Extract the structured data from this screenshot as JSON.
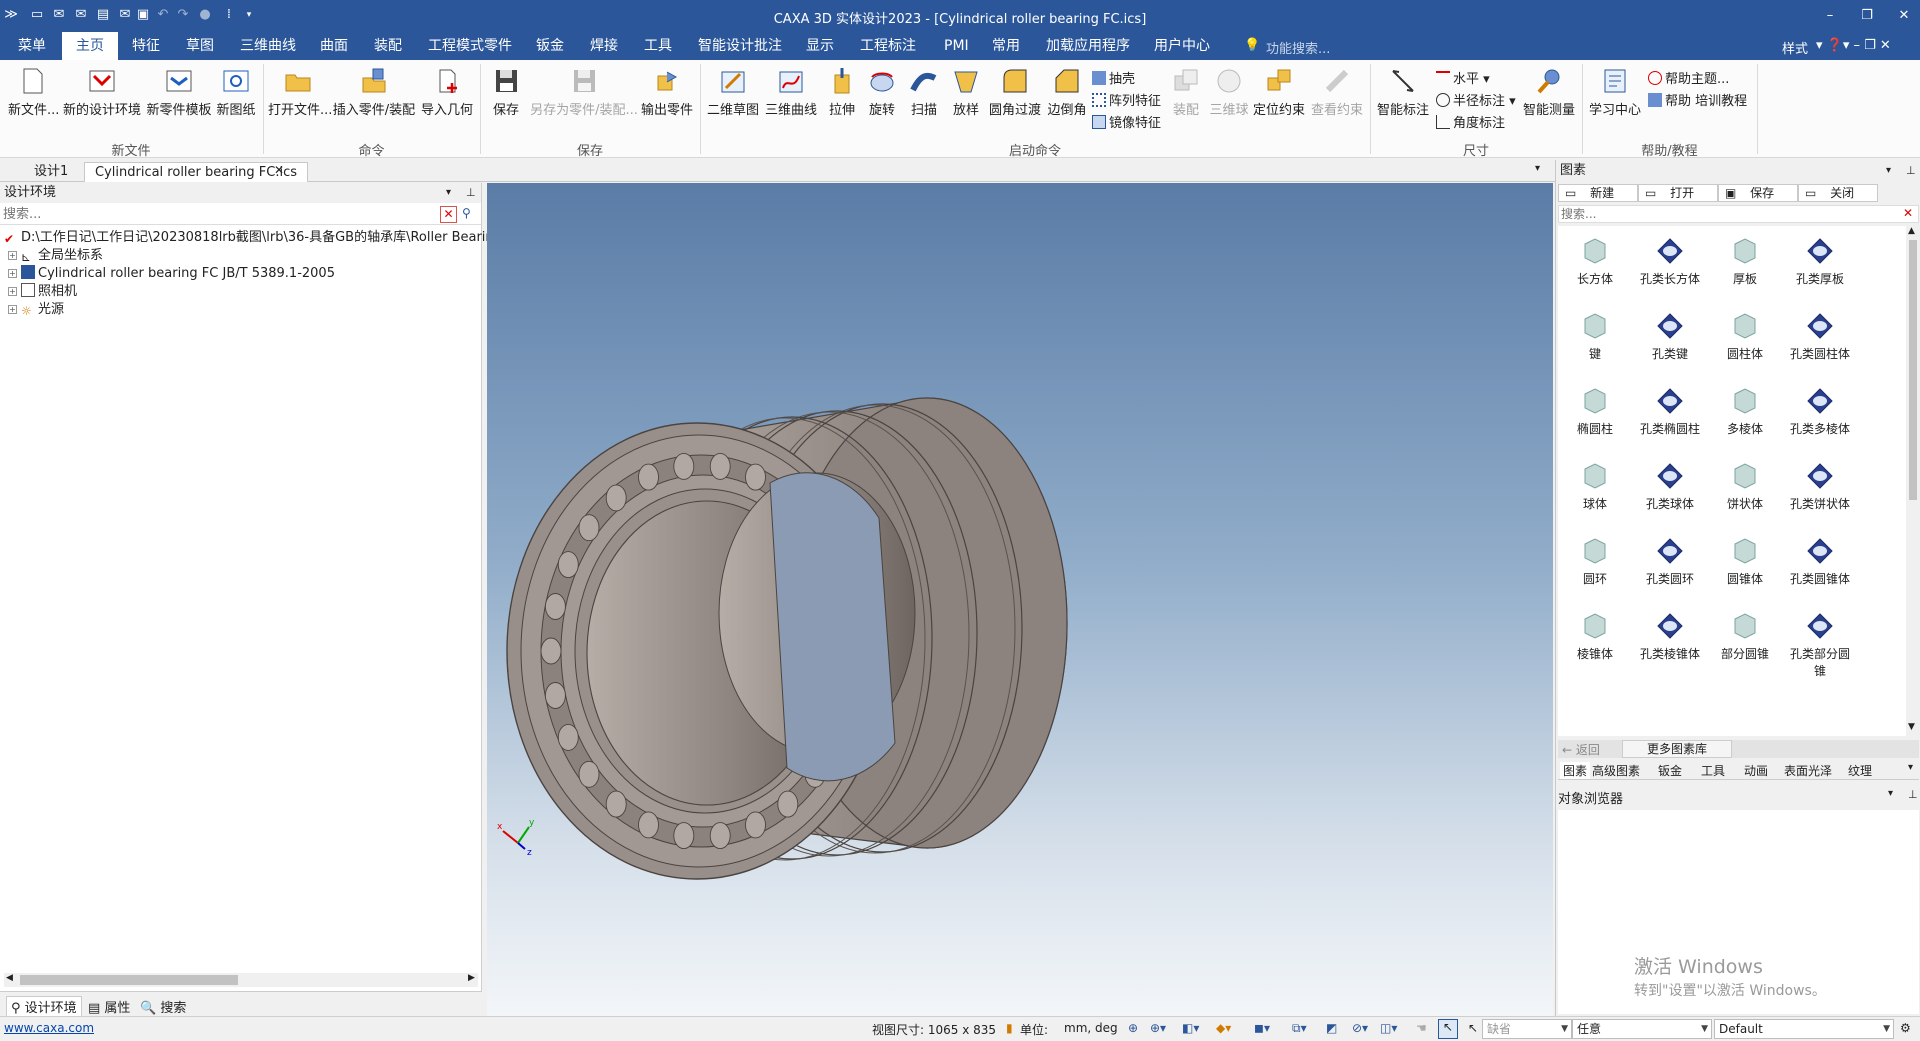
{
  "window": {
    "title": "CAXA 3D 实体设计2023 - [Cylindrical roller bearing FC.ics]"
  },
  "menu_tabs": [
    "菜单",
    "主页",
    "特征",
    "草图",
    "三维曲线",
    "曲面",
    "装配",
    "工程模式零件",
    "钣金",
    "焊接",
    "工具",
    "智能设计批注",
    "显示",
    "工程标注",
    "PMI",
    "常用",
    "加载应用程序",
    "用户中心"
  ],
  "menu_active": "主页",
  "function_search": "功能搜索...",
  "style_label": "样式",
  "ribbon": {
    "new_file": {
      "btn1": "新文件...",
      "btn2": "新的设计环境",
      "btn3": "新零件模板",
      "btn4": "新图纸",
      "group": "新文件"
    },
    "command": {
      "btn1": "打开文件...",
      "btn2": "插入零件/装配",
      "btn3": "导入几何",
      "group": "命令"
    },
    "save": {
      "btn1": "保存",
      "btn2": "另存为零件/装配...",
      "btn3": "输出零件",
      "group": "保存"
    },
    "launch": {
      "btn1": "二维草图",
      "btn2": "三维曲线",
      "btn3": "拉伸",
      "btn4": "旋转",
      "btn5": "扫描",
      "btn6": "放样",
      "btn7": "圆角过渡",
      "btn8": "边倒角",
      "s1": "抽壳",
      "s2": "阵列特征",
      "s3": "镜像特征",
      "btn9": "装配",
      "btn10": "三维球",
      "btn11": "定位约束",
      "btn12": "查看约束",
      "group": "启动命令"
    },
    "dimension": {
      "btn1": "智能标注",
      "s1": "水平",
      "s2": "半径标注",
      "s3": "角度标注",
      "btn2": "智能测量",
      "group": "尺寸"
    },
    "help": {
      "btn1": "学习中心",
      "s1": "帮助主题...",
      "s2": "帮助 培训教程",
      "group": "帮助/教程"
    }
  },
  "doc_tabs": [
    "设计1",
    "Cylindrical roller bearing FC.ics"
  ],
  "left_panel": {
    "title": "设计环境",
    "search_placeholder": "搜索...",
    "tree": {
      "root": "D:\\工作日记\\工作日记\\20230818lrb截图\\lrb\\36-具备GB的轴承库\\Roller Bearings\\",
      "item1": "全局坐标系",
      "item2": "Cylindrical roller bearing FC JB/T 5389.1-2005",
      "item3": "照相机",
      "item4": "光源"
    },
    "bottom_tabs": [
      "设计环境",
      "属性",
      "搜索"
    ]
  },
  "right_panel": {
    "title": "图素",
    "buttons": [
      "新建",
      "打开",
      "保存",
      "关闭"
    ],
    "search_placeholder": "搜索...",
    "items": [
      "长方体",
      "孔类长方体",
      "厚板",
      "孔类厚板",
      "键",
      "孔类键",
      "圆柱体",
      "孔类圆柱体",
      "椭圆柱",
      "孔类椭圆柱",
      "多棱体",
      "孔类多棱体",
      "球体",
      "孔类球体",
      "饼状体",
      "孔类饼状体",
      "圆环",
      "孔类圆环",
      "圆锥体",
      "孔类圆锥体",
      "棱锥体",
      "孔类棱锥体",
      "部分圆锥",
      "孔类部分圆锥"
    ],
    "back_label": "返回",
    "more_label": "更多图素库",
    "bottom_tabs": [
      "图素",
      "高级图素",
      "钣金",
      "工具",
      "动画",
      "表面光泽",
      "纹理"
    ],
    "object_browser": "对象浏览器",
    "watermark1": "激活 Windows",
    "watermark2": "转到\"设置\"以激活 Windows。"
  },
  "status": {
    "link": "www.caxa.com",
    "view_size": "视图尺寸: 1065 x  835",
    "unit_label": "单位:",
    "unit_value": "mm, deg",
    "combo1": "缺省",
    "combo2": "任意",
    "combo3": "Default"
  },
  "colors": {
    "title_bg": "#2b579a",
    "bearing": "#8f8580"
  }
}
